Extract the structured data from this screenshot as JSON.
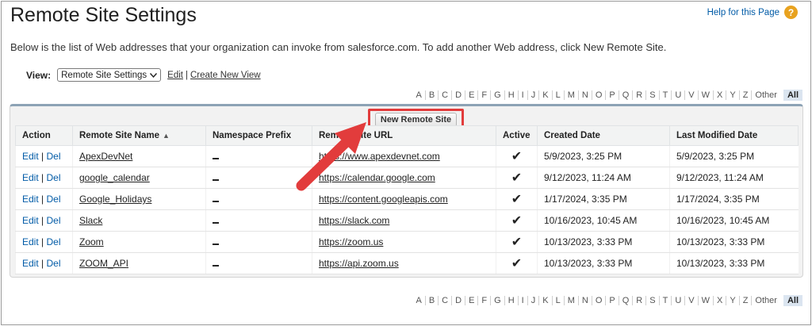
{
  "header": {
    "title": "Remote Site Settings",
    "help_label": "Help for this Page",
    "help_icon": "question-icon"
  },
  "intro": "Below is the list of Web addresses that your organization can invoke from salesforce.com. To add another Web address, click New Remote Site.",
  "view": {
    "label": "View:",
    "selected": "Remote Site Settings",
    "edit_label": "Edit",
    "separator": "|",
    "create_label": "Create New View"
  },
  "alphabet": {
    "letters": [
      "A",
      "B",
      "C",
      "D",
      "E",
      "F",
      "G",
      "H",
      "I",
      "J",
      "K",
      "L",
      "M",
      "N",
      "O",
      "P",
      "Q",
      "R",
      "S",
      "T",
      "U",
      "V",
      "W",
      "X",
      "Y",
      "Z"
    ],
    "other": "Other",
    "all": "All"
  },
  "new_button_label": "New Remote Site",
  "table": {
    "columns": {
      "action": "Action",
      "name": "Remote Site Name",
      "prefix": "Namespace Prefix",
      "url": "Remote Site URL",
      "active": "Active",
      "created": "Created Date",
      "modified": "Last Modified Date"
    },
    "action_edit": "Edit",
    "action_sep": "|",
    "action_del": "Del",
    "rows": [
      {
        "name": "ApexDevNet",
        "prefix": "",
        "url": "https://www.apexdevnet.com",
        "active": "✔",
        "created": "5/9/2023, 3:25 PM",
        "modified": "5/9/2023, 3:25 PM"
      },
      {
        "name": "google_calendar",
        "prefix": "",
        "url": "https://calendar.google.com",
        "active": "✔",
        "created": "9/12/2023, 11:24 AM",
        "modified": "9/12/2023, 11:24 AM"
      },
      {
        "name": "Google_Holidays",
        "prefix": "",
        "url": "https://content.googleapis.com",
        "active": "✔",
        "created": "1/17/2024, 3:35 PM",
        "modified": "1/17/2024, 3:35 PM"
      },
      {
        "name": "Slack",
        "prefix": "",
        "url": "https://slack.com",
        "active": "✔",
        "created": "10/16/2023, 10:45 AM",
        "modified": "10/16/2023, 10:45 AM"
      },
      {
        "name": "Zoom",
        "prefix": "",
        "url": "https://zoom.us",
        "active": "✔",
        "created": "10/13/2023, 3:33 PM",
        "modified": "10/13/2023, 3:33 PM"
      },
      {
        "name": "ZOOM_API",
        "prefix": "",
        "url": "https://api.zoom.us",
        "active": "✔",
        "created": "10/13/2023, 3:33 PM",
        "modified": "10/13/2023, 3:33 PM"
      }
    ]
  },
  "colors": {
    "link": "#015ba7",
    "highlight": "#e23c3c"
  }
}
